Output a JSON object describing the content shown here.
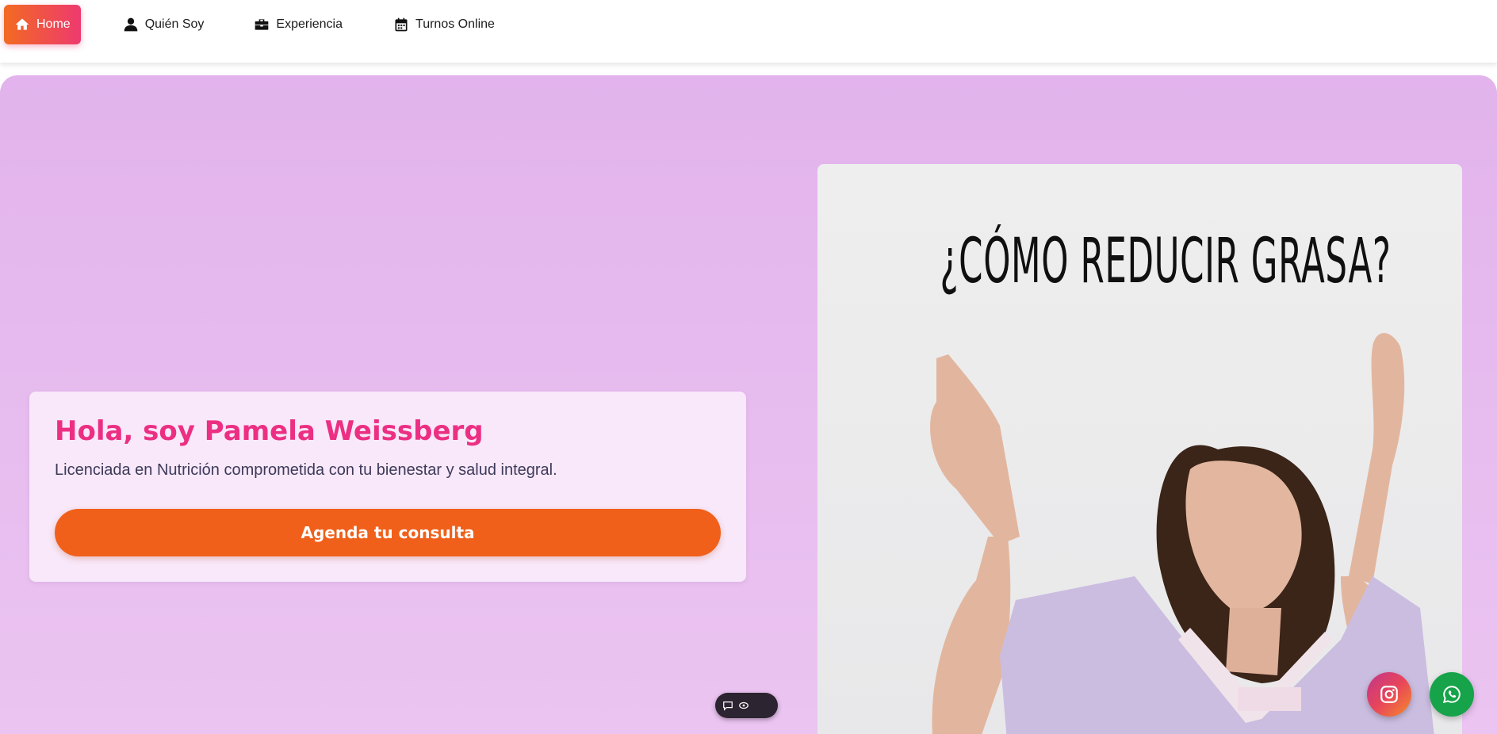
{
  "nav": {
    "items": [
      {
        "label": "Home",
        "icon": "home-icon",
        "active": true
      },
      {
        "label": "Quién Soy",
        "icon": "user-icon",
        "active": false
      },
      {
        "label": "Experiencia",
        "icon": "briefcase-icon",
        "active": false
      },
      {
        "label": "Turnos Online",
        "icon": "calendar-icon",
        "active": false
      }
    ]
  },
  "hero": {
    "title": "Hola, soy Pamela Weissberg",
    "subtitle": "Licenciada en Nutrición comprometida con tu bienestar y salud integral.",
    "cta_label": "Agenda tu consulta"
  },
  "promo": {
    "headline": "¿CÓMO REDUCIR GRASA?"
  },
  "floating": {
    "toolbar_icons": [
      "comment-icon",
      "eye-icon"
    ],
    "instagram_icon": "instagram-icon",
    "whatsapp_icon": "whatsapp-icon"
  },
  "colors": {
    "brand_pink": "#ec2f83",
    "cta_orange": "#f0601a",
    "hero_bg": "#e2b3ec",
    "whatsapp_green": "#16a34a"
  }
}
